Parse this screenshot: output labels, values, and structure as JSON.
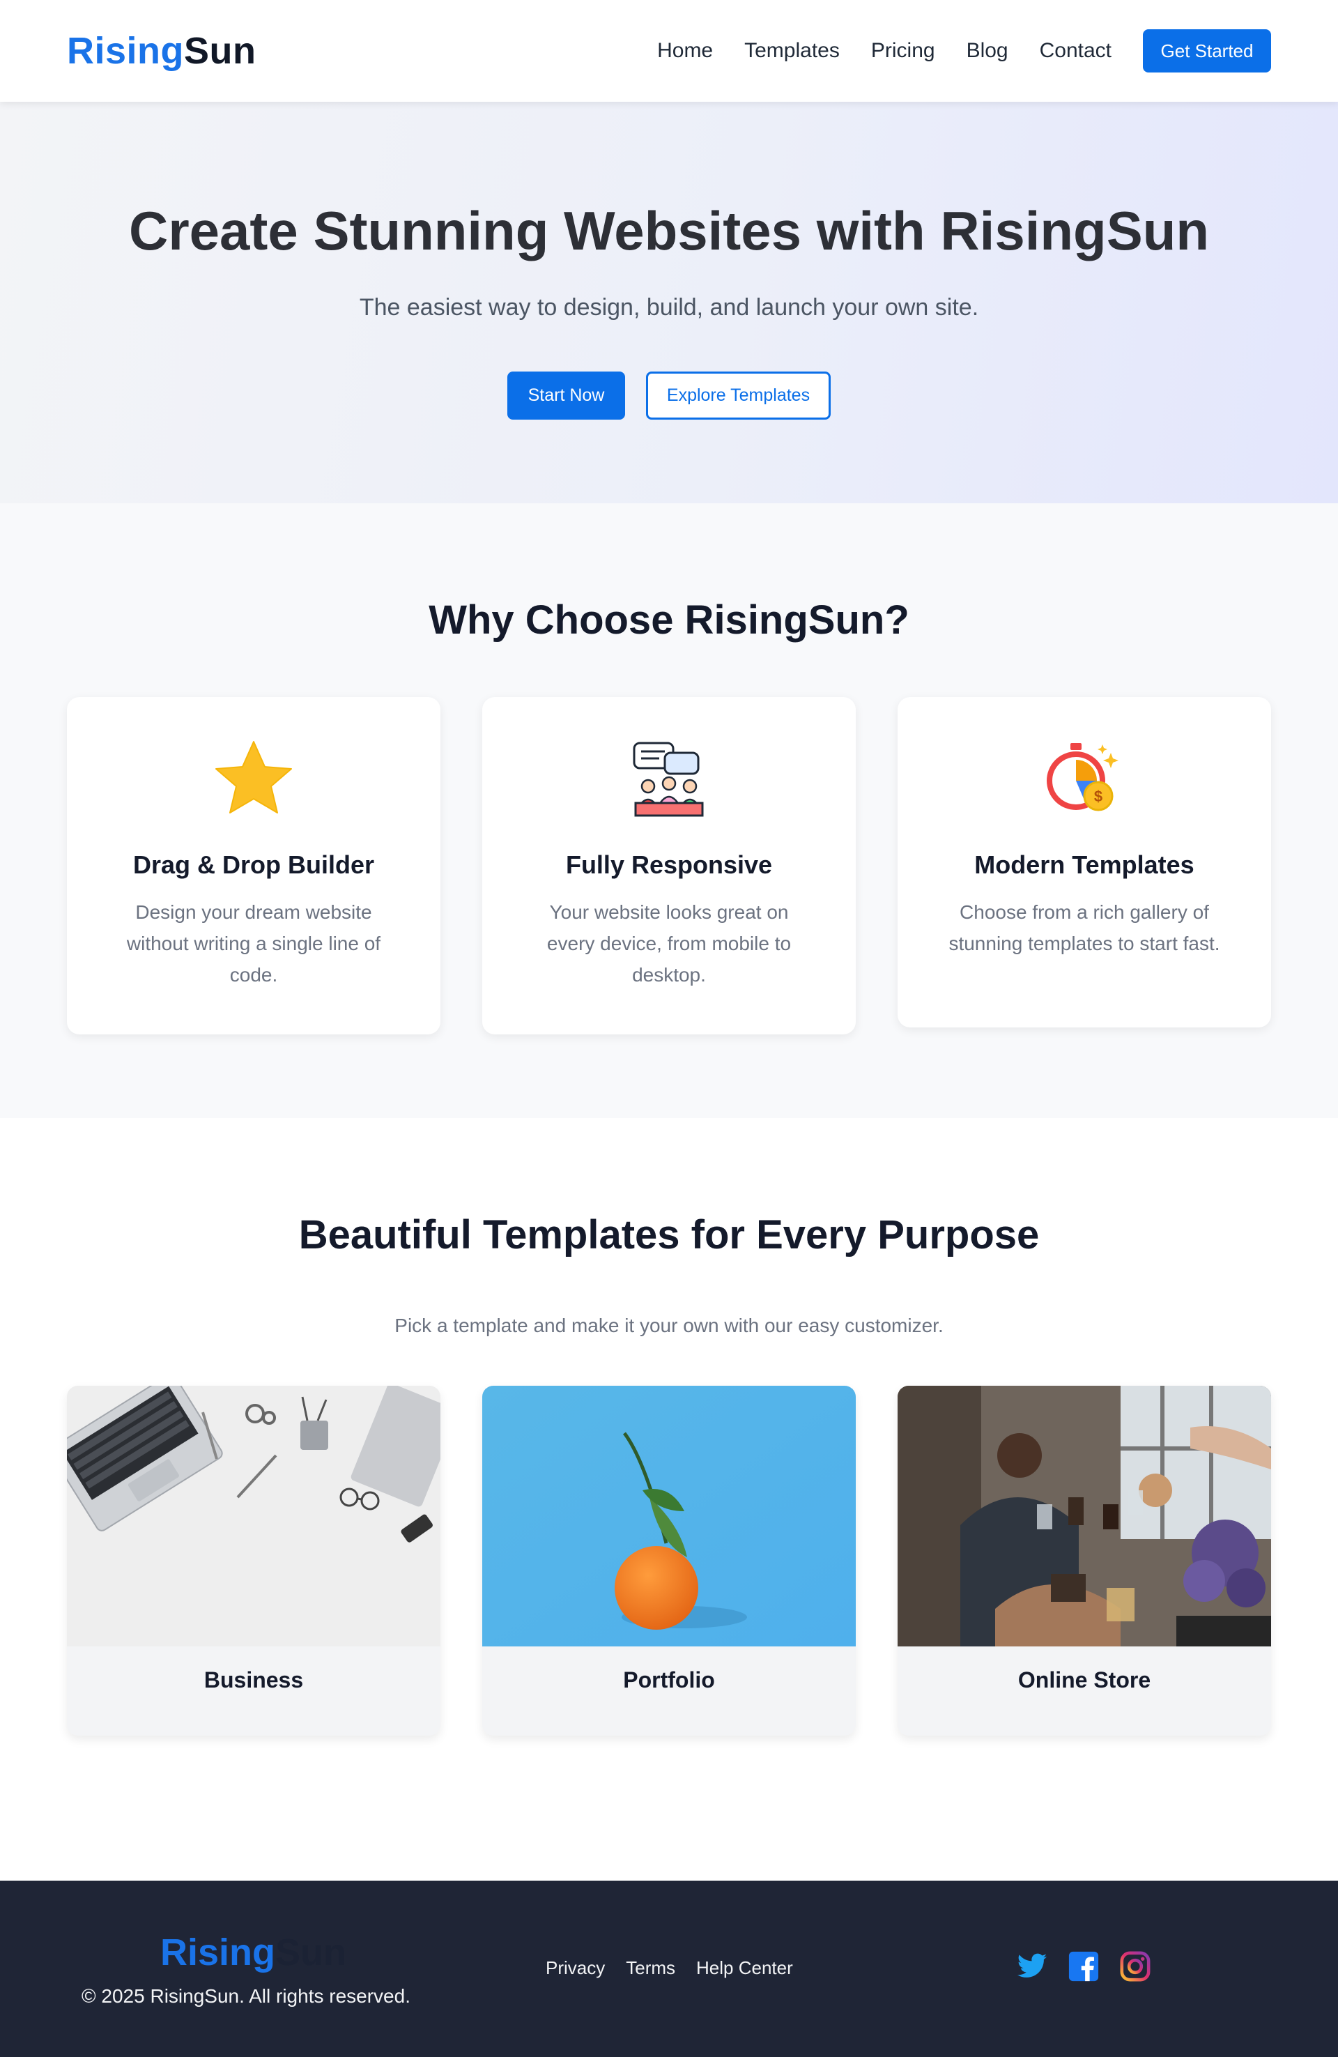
{
  "brand": {
    "part1": "Rising",
    "part2": "Sun",
    "primary_color": "#0b6fe8"
  },
  "nav": {
    "links": [
      "Home",
      "Templates",
      "Pricing",
      "Blog",
      "Contact"
    ],
    "cta": "Get Started"
  },
  "hero": {
    "title": "Create Stunning Websites with RisingSun",
    "subtitle": "The easiest way to design, build, and launch your own site.",
    "primary_button": "Start Now",
    "secondary_button": "Explore Templates"
  },
  "features": {
    "title": "Why Choose RisingSun?",
    "items": [
      {
        "icon": "star-icon",
        "title": "Drag & Drop Builder",
        "desc": "Design your dream website without writing a single line of code."
      },
      {
        "icon": "chat-meeting-icon",
        "title": "Fully Responsive",
        "desc": "Your website looks great on every device, from mobile to desktop."
      },
      {
        "icon": "stopwatch-coin-icon",
        "title": "Modern Templates",
        "desc": "Choose from a rich gallery of stunning templates to start fast."
      }
    ]
  },
  "templates": {
    "title": "Beautiful Templates for Every Purpose",
    "subtitle": "Pick a template and make it your own with our easy customizer.",
    "items": [
      {
        "label": "Business",
        "image": "workspace-desk-photo"
      },
      {
        "label": "Portfolio",
        "image": "orange-on-blue-photo"
      },
      {
        "label": "Online Store",
        "image": "friends-toasting-photo"
      }
    ]
  },
  "footer": {
    "copyright": "© 2025 RisingSun. All rights reserved.",
    "links": [
      "Privacy",
      "Terms",
      "Help Center"
    ],
    "social": [
      "twitter-icon",
      "facebook-icon",
      "instagram-icon"
    ]
  }
}
